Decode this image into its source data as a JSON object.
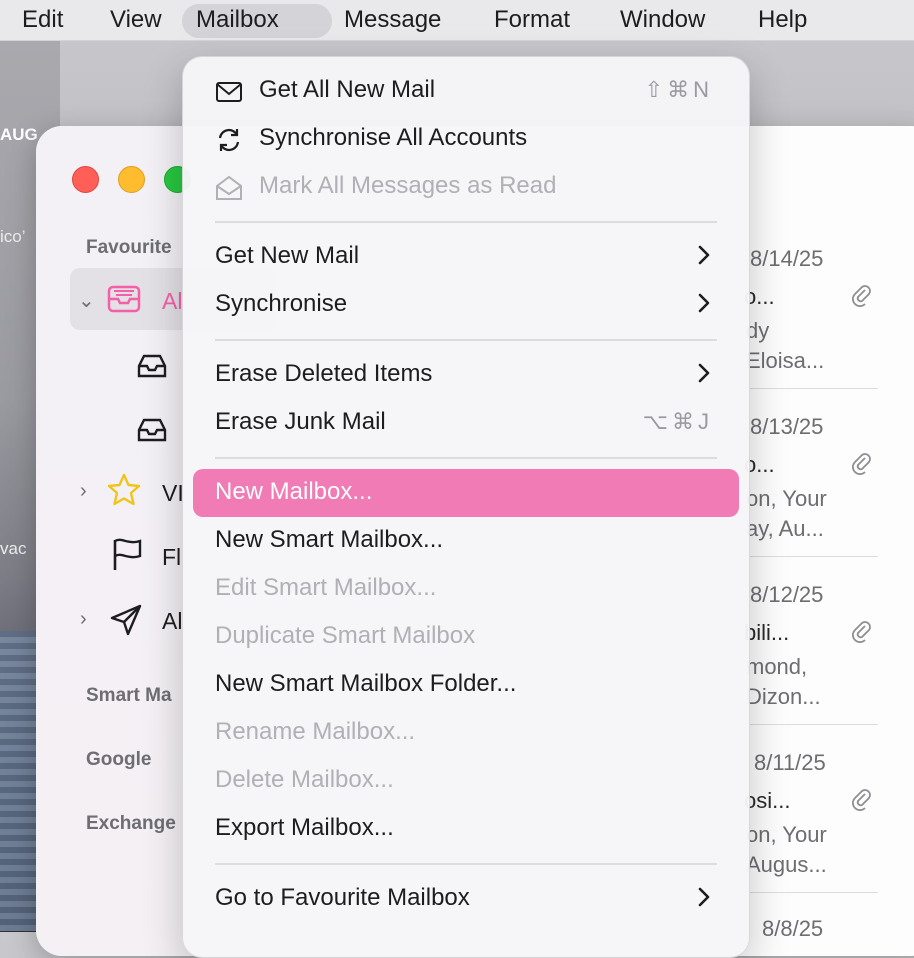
{
  "menubar": {
    "items": [
      "Edit",
      "View",
      "Mailbox",
      "Message",
      "Format",
      "Window",
      "Help"
    ],
    "active": "Mailbox"
  },
  "desktop": {
    "label_1": "AUG",
    "label_2": "ico’",
    "label_3": "vac"
  },
  "sidebar": {
    "favourites_header": "Favourite",
    "items": [
      {
        "label": "Al",
        "icon": "tray-icon"
      },
      {
        "label": "",
        "icon": "inbox-icon"
      },
      {
        "label": "",
        "icon": "inbox-icon"
      },
      {
        "label": "VI",
        "icon": "star-icon"
      },
      {
        "label": "Fl",
        "icon": "flag-icon"
      },
      {
        "label": "Al",
        "icon": "paperplane-icon"
      }
    ],
    "smart_header": "Smart Ma",
    "google_header": "Google",
    "exchange_header": "Exchange"
  },
  "messages": [
    {
      "date": "8/14/25",
      "subject": "o...",
      "line1": "dy",
      "line2": "Eloisa..."
    },
    {
      "date": "8/13/25",
      "subject": "o...",
      "line1": "on, Your",
      "line2": "ay, Au..."
    },
    {
      "date": "8/12/25",
      "subject": "bili...",
      "line1": "mond,",
      "line2": "Dizon..."
    },
    {
      "date": "8/11/25",
      "subject": "osi...",
      "line1": "on, Your",
      "line2": "Augus..."
    },
    {
      "date": "8/8/25",
      "subject": "",
      "line1": "",
      "line2": ""
    }
  ],
  "accent_color": "#f45fa7",
  "highlight_color": "#f17bb5",
  "menu": {
    "get_all_new_mail": {
      "label": "Get All New Mail",
      "shortcut": "⇧⌘N",
      "icon": "envelope-icon"
    },
    "sync_all": {
      "label": "Synchronise All Accounts",
      "icon": "sync-icon"
    },
    "mark_all_read": {
      "label": "Mark All Messages as Read",
      "icon": "envelope-open-icon"
    },
    "get_new_mail": {
      "label": "Get New Mail"
    },
    "synchronise": {
      "label": "Synchronise"
    },
    "erase_deleted": {
      "label": "Erase Deleted Items"
    },
    "erase_junk": {
      "label": "Erase Junk Mail",
      "shortcut": "⌥⌘J"
    },
    "new_mailbox": {
      "label": "New Mailbox..."
    },
    "new_smart_mailbox": {
      "label": "New Smart Mailbox..."
    },
    "edit_smart_mailbox": {
      "label": "Edit Smart Mailbox..."
    },
    "duplicate_smart_mailbox": {
      "label": "Duplicate Smart Mailbox"
    },
    "new_smart_mailbox_folder": {
      "label": "New Smart Mailbox Folder..."
    },
    "rename_mailbox": {
      "label": "Rename Mailbox..."
    },
    "delete_mailbox": {
      "label": "Delete Mailbox..."
    },
    "export_mailbox": {
      "label": "Export Mailbox..."
    },
    "go_to_favourite": {
      "label": "Go to Favourite Mailbox"
    }
  }
}
